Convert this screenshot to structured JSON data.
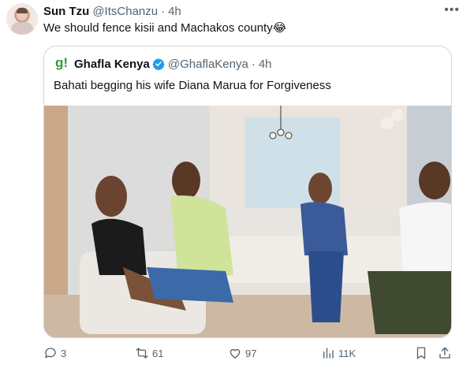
{
  "tweet": {
    "author_name": "Sun Tzu",
    "author_handle": "@ItsChanzu",
    "separator": "·",
    "timestamp": "4h",
    "more_icon": "more-icon",
    "text": "We should fence kisii and Machakos county😂"
  },
  "quoted": {
    "logo_text": "g!",
    "author_name": "Ghafla Kenya",
    "verified_icon": "verified-badge-icon",
    "author_handle": "@GhaflaKenya",
    "separator": "·",
    "timestamp": "4h",
    "text": "Bahati begging his wife Diana Marua for Forgiveness",
    "media": "video-still"
  },
  "actions": {
    "reply_count": "3",
    "retweet_count": "61",
    "like_count": "97",
    "views_count": "11K"
  },
  "colors": {
    "text": "#0f1419",
    "secondary": "#536471",
    "border": "#cfd9de",
    "verified": "#1d9bf0",
    "brand_green": "#2e9d3a"
  }
}
